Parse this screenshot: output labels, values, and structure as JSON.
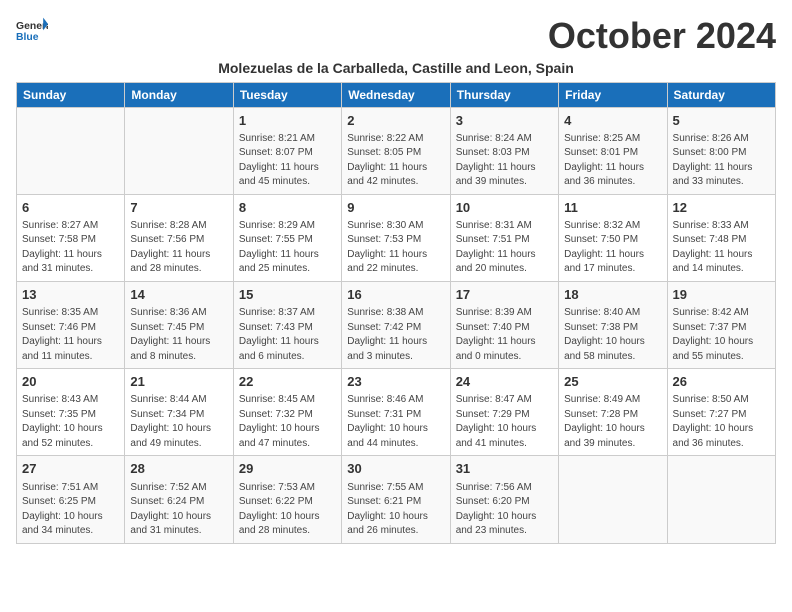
{
  "logo": {
    "general": "General",
    "blue": "Blue"
  },
  "title": "October 2024",
  "location": "Molezuelas de la Carballeda, Castille and Leon, Spain",
  "days_of_week": [
    "Sunday",
    "Monday",
    "Tuesday",
    "Wednesday",
    "Thursday",
    "Friday",
    "Saturday"
  ],
  "weeks": [
    [
      {
        "day": "",
        "info": ""
      },
      {
        "day": "",
        "info": ""
      },
      {
        "day": "1",
        "info": "Sunrise: 8:21 AM\nSunset: 8:07 PM\nDaylight: 11 hours and 45 minutes."
      },
      {
        "day": "2",
        "info": "Sunrise: 8:22 AM\nSunset: 8:05 PM\nDaylight: 11 hours and 42 minutes."
      },
      {
        "day": "3",
        "info": "Sunrise: 8:24 AM\nSunset: 8:03 PM\nDaylight: 11 hours and 39 minutes."
      },
      {
        "day": "4",
        "info": "Sunrise: 8:25 AM\nSunset: 8:01 PM\nDaylight: 11 hours and 36 minutes."
      },
      {
        "day": "5",
        "info": "Sunrise: 8:26 AM\nSunset: 8:00 PM\nDaylight: 11 hours and 33 minutes."
      }
    ],
    [
      {
        "day": "6",
        "info": "Sunrise: 8:27 AM\nSunset: 7:58 PM\nDaylight: 11 hours and 31 minutes."
      },
      {
        "day": "7",
        "info": "Sunrise: 8:28 AM\nSunset: 7:56 PM\nDaylight: 11 hours and 28 minutes."
      },
      {
        "day": "8",
        "info": "Sunrise: 8:29 AM\nSunset: 7:55 PM\nDaylight: 11 hours and 25 minutes."
      },
      {
        "day": "9",
        "info": "Sunrise: 8:30 AM\nSunset: 7:53 PM\nDaylight: 11 hours and 22 minutes."
      },
      {
        "day": "10",
        "info": "Sunrise: 8:31 AM\nSunset: 7:51 PM\nDaylight: 11 hours and 20 minutes."
      },
      {
        "day": "11",
        "info": "Sunrise: 8:32 AM\nSunset: 7:50 PM\nDaylight: 11 hours and 17 minutes."
      },
      {
        "day": "12",
        "info": "Sunrise: 8:33 AM\nSunset: 7:48 PM\nDaylight: 11 hours and 14 minutes."
      }
    ],
    [
      {
        "day": "13",
        "info": "Sunrise: 8:35 AM\nSunset: 7:46 PM\nDaylight: 11 hours and 11 minutes."
      },
      {
        "day": "14",
        "info": "Sunrise: 8:36 AM\nSunset: 7:45 PM\nDaylight: 11 hours and 8 minutes."
      },
      {
        "day": "15",
        "info": "Sunrise: 8:37 AM\nSunset: 7:43 PM\nDaylight: 11 hours and 6 minutes."
      },
      {
        "day": "16",
        "info": "Sunrise: 8:38 AM\nSunset: 7:42 PM\nDaylight: 11 hours and 3 minutes."
      },
      {
        "day": "17",
        "info": "Sunrise: 8:39 AM\nSunset: 7:40 PM\nDaylight: 11 hours and 0 minutes."
      },
      {
        "day": "18",
        "info": "Sunrise: 8:40 AM\nSunset: 7:38 PM\nDaylight: 10 hours and 58 minutes."
      },
      {
        "day": "19",
        "info": "Sunrise: 8:42 AM\nSunset: 7:37 PM\nDaylight: 10 hours and 55 minutes."
      }
    ],
    [
      {
        "day": "20",
        "info": "Sunrise: 8:43 AM\nSunset: 7:35 PM\nDaylight: 10 hours and 52 minutes."
      },
      {
        "day": "21",
        "info": "Sunrise: 8:44 AM\nSunset: 7:34 PM\nDaylight: 10 hours and 49 minutes."
      },
      {
        "day": "22",
        "info": "Sunrise: 8:45 AM\nSunset: 7:32 PM\nDaylight: 10 hours and 47 minutes."
      },
      {
        "day": "23",
        "info": "Sunrise: 8:46 AM\nSunset: 7:31 PM\nDaylight: 10 hours and 44 minutes."
      },
      {
        "day": "24",
        "info": "Sunrise: 8:47 AM\nSunset: 7:29 PM\nDaylight: 10 hours and 41 minutes."
      },
      {
        "day": "25",
        "info": "Sunrise: 8:49 AM\nSunset: 7:28 PM\nDaylight: 10 hours and 39 minutes."
      },
      {
        "day": "26",
        "info": "Sunrise: 8:50 AM\nSunset: 7:27 PM\nDaylight: 10 hours and 36 minutes."
      }
    ],
    [
      {
        "day": "27",
        "info": "Sunrise: 7:51 AM\nSunset: 6:25 PM\nDaylight: 10 hours and 34 minutes."
      },
      {
        "day": "28",
        "info": "Sunrise: 7:52 AM\nSunset: 6:24 PM\nDaylight: 10 hours and 31 minutes."
      },
      {
        "day": "29",
        "info": "Sunrise: 7:53 AM\nSunset: 6:22 PM\nDaylight: 10 hours and 28 minutes."
      },
      {
        "day": "30",
        "info": "Sunrise: 7:55 AM\nSunset: 6:21 PM\nDaylight: 10 hours and 26 minutes."
      },
      {
        "day": "31",
        "info": "Sunrise: 7:56 AM\nSunset: 6:20 PM\nDaylight: 10 hours and 23 minutes."
      },
      {
        "day": "",
        "info": ""
      },
      {
        "day": "",
        "info": ""
      }
    ]
  ]
}
